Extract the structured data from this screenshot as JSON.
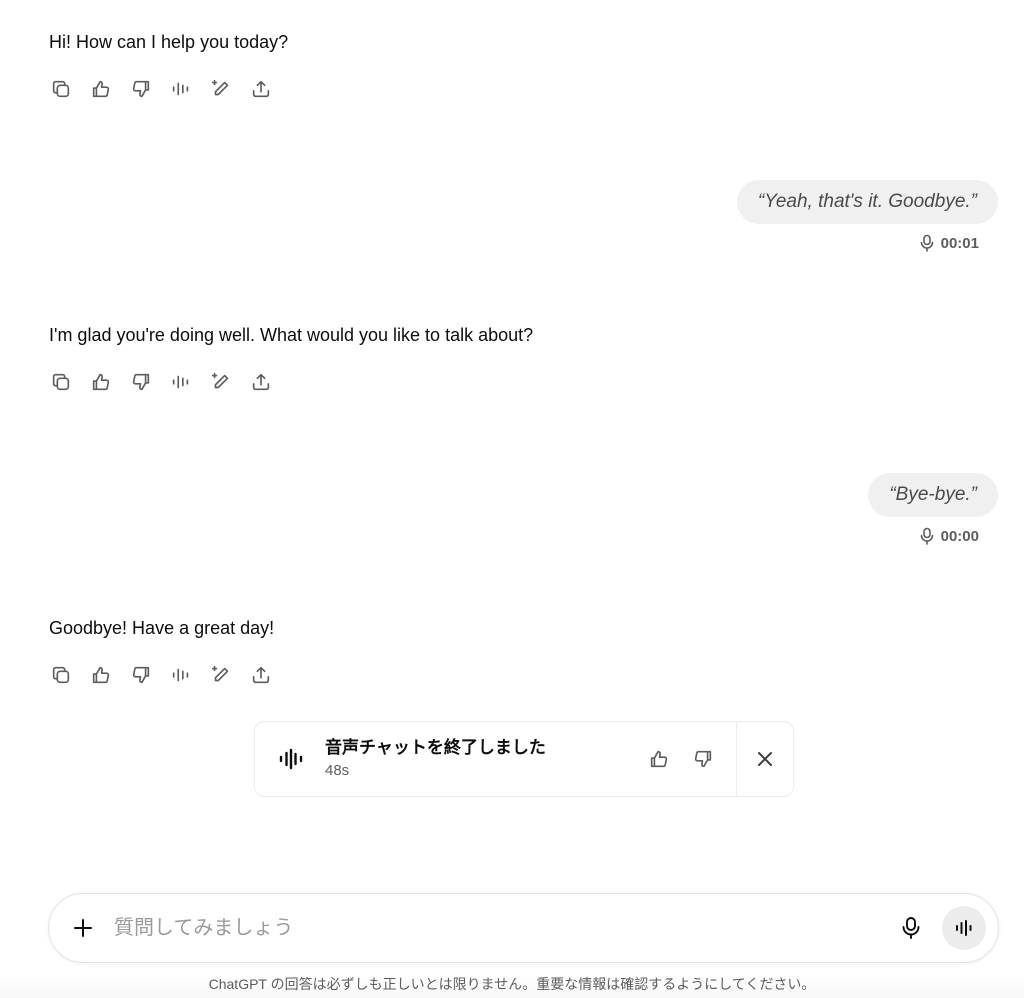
{
  "messages": [
    {
      "role": "assistant",
      "text": "Hi! How can I help you today?"
    },
    {
      "role": "user",
      "text": "“Yeah, that's it. Goodbye.”",
      "duration": "00:01"
    },
    {
      "role": "assistant",
      "text": "I'm glad you're doing well. What would you like to talk about?"
    },
    {
      "role": "user",
      "text": "“Bye-bye.”",
      "duration": "00:00"
    },
    {
      "role": "assistant",
      "text": "Goodbye! Have a great day!"
    }
  ],
  "assistant_actions": [
    "copy-icon",
    "thumbs-up-icon",
    "thumbs-down-icon",
    "read-aloud-icon",
    "edit-icon",
    "share-icon"
  ],
  "voice_chat_card": {
    "title": "音声チャットを終了しました",
    "duration": "48s"
  },
  "composer": {
    "placeholder": "質問してみましょう"
  },
  "footer": {
    "disclaimer": "ChatGPT の回答は必ずしも正しいとは限りません。重要な情報は確認するようにしてください。"
  },
  "colors": {
    "text": "#0d0d0d",
    "muted": "#5d5d5d",
    "bubble": "#f0f0f0",
    "border": "#e3e3e3"
  }
}
